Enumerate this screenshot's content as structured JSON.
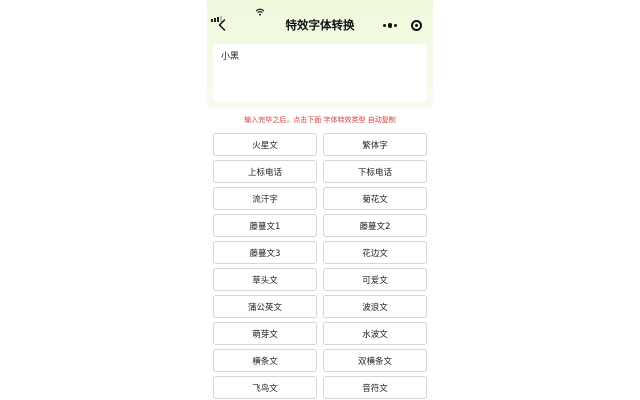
{
  "nav": {
    "title": "特效字体转换",
    "back_icon": "chevron-left-icon"
  },
  "input": {
    "value": "小黑"
  },
  "hint": "输入完毕之后，点击下面 字体特效类型 自动复制",
  "buttons": [
    [
      "火星文",
      "繁体字"
    ],
    [
      "上标电话",
      "下标电话"
    ],
    [
      "流汗字",
      "菊花文"
    ],
    [
      "藤蔓文1",
      "藤蔓文2"
    ],
    [
      "藤蔓文3",
      "花边文"
    ],
    [
      "草头文",
      "可爱文"
    ],
    [
      "蒲公英文",
      "波浪文"
    ],
    [
      "萌芽文",
      "水波文"
    ],
    [
      "横条文",
      "双横条文"
    ],
    [
      "飞鸟文",
      "音符文"
    ]
  ],
  "colors": {
    "accent_hint": "#e23c3c",
    "header_bg": "#eef9dc"
  }
}
